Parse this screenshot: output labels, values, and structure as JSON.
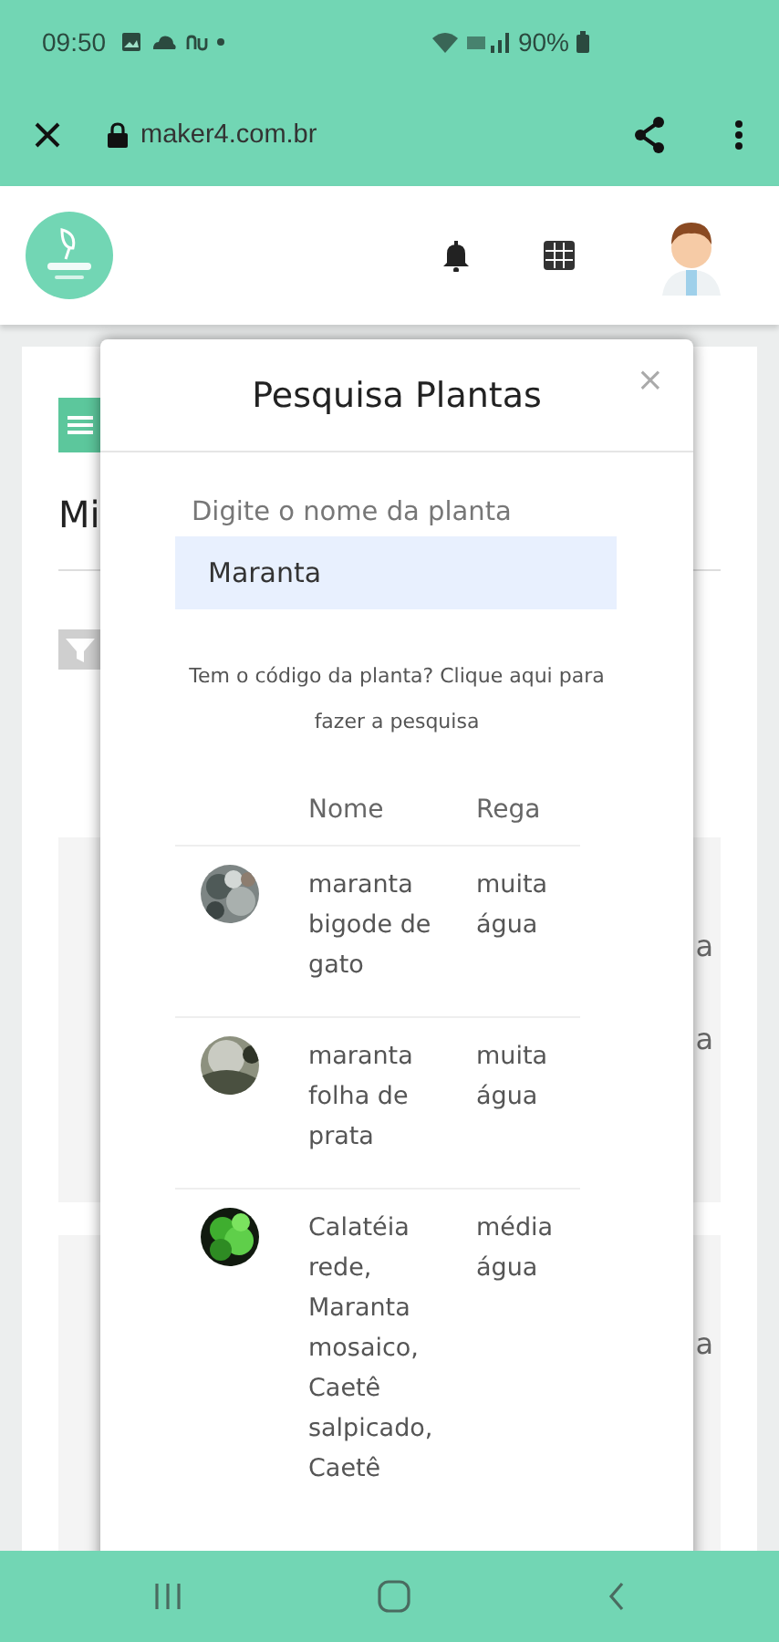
{
  "status_bar": {
    "time": "09:50",
    "battery": "90%"
  },
  "browser": {
    "url": "maker4.com.br"
  },
  "background_page": {
    "title_fragment": "Mi",
    "row_fragments": [
      "a",
      "a",
      "a"
    ]
  },
  "modal": {
    "title": "Pesquisa Plantas",
    "close": "×",
    "search": {
      "label": "Digite o nome da planta",
      "value": "Maranta"
    },
    "link_text": "Tem o código da planta? Clique aqui para fazer a pesquisa",
    "table": {
      "columns": [
        "Nome",
        "Rega"
      ],
      "rows": [
        {
          "name": "maranta bigode de gato",
          "rega": "muita água",
          "kind": "picture"
        },
        {
          "name": "maranta folha de prata",
          "rega": "muita água",
          "kind": "picture"
        },
        {
          "name": "Calatéia rede, Maranta mosaico, Caetê salpicado, Caetê",
          "rega": "média água",
          "kind": "picture"
        }
      ]
    }
  }
}
